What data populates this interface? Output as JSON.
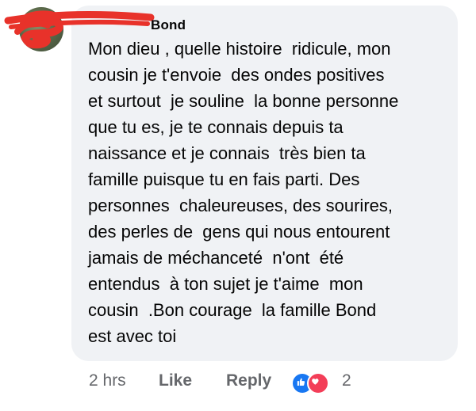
{
  "comment": {
    "author_name": "Bond",
    "text_lines": [
      "Mon dieu , quelle histoire  ridicule, mon",
      "cousin je t'envoie  des ondes positives",
      "et surtout  je souline  la bonne personne",
      "que tu es, je te connais depuis ta",
      "naissance et je connais  très bien ta",
      "famille puisque tu en fais parti. Des",
      "personnes  chaleureuses, des sourires,",
      "des perles de  gens qui nous entourent",
      "jamais de méchanceté  n'ont  été",
      "entendus  à ton sujet je t'aime  mon",
      "cousin  .Bon courage  la famille Bond",
      "est avec toi"
    ]
  },
  "actions": {
    "timestamp": "2 hrs",
    "like_label": "Like",
    "reply_label": "Reply",
    "reaction_count": "2",
    "reaction_icons": [
      "like-reaction-icon",
      "love-reaction-icon"
    ]
  },
  "colors": {
    "bubble_bg": "#f0f2f5",
    "meta_text": "#65676b",
    "like_blue": "#1877f2",
    "love_red": "#f33e58",
    "redaction_red": "#e8322a"
  }
}
